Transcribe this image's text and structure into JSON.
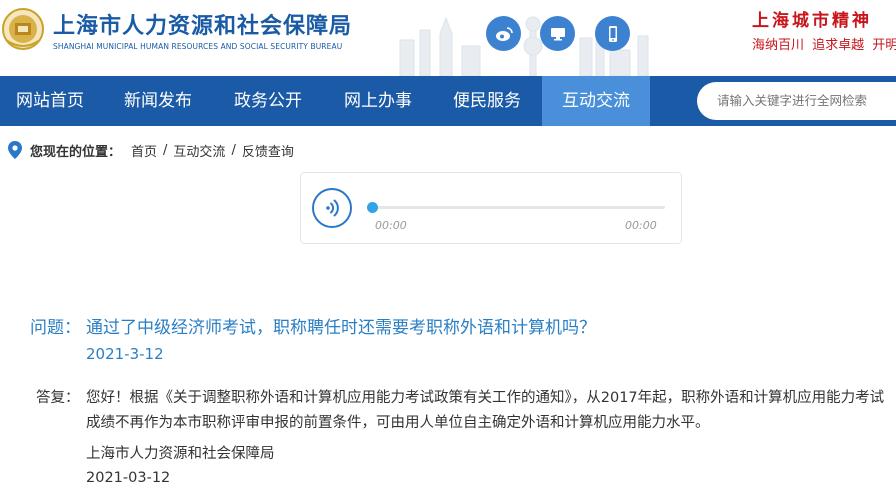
{
  "header": {
    "title": "上海市人力资源和社会保障局",
    "subtitle": "SHANGHAI MUNICIPAL HUMAN RESOURCES AND SOCIAL SECURITY BUREAU",
    "spirit": "上海城市精神",
    "motto": "海纳百川 追求卓越 开明"
  },
  "social": {
    "weibo_icon": "weibo-icon",
    "desktop_icon": "desktop-icon",
    "mobile_icon": "mobile-icon"
  },
  "nav": {
    "items": [
      {
        "label": "网站首页"
      },
      {
        "label": "新闻发布"
      },
      {
        "label": "政务公开"
      },
      {
        "label": "网上办事"
      },
      {
        "label": "便民服务"
      },
      {
        "label": "互动交流",
        "active": true
      }
    ],
    "search_placeholder": "请输入关键字进行全网检索"
  },
  "breadcrumb": {
    "label": "您现在的位置：",
    "items": [
      "首页",
      "互动交流",
      "反馈查询"
    ],
    "separator": "/"
  },
  "player": {
    "current_time": "00:00",
    "total_time": "00:00",
    "progress": 0
  },
  "qa": {
    "question_label": "问题：",
    "question": "通过了中级经济师考试，职称聘任时还需要考职称外语和计算机吗？",
    "question_date": "2021-3-12",
    "answer_label": "答复：",
    "answer": "您好！根据《关于调整职称外语和计算机应用能力考试政策有关工作的通知》，从2017年起，职称外语和计算机应用能力考试成绩不再作为本市职称评审申报的前置条件，可由用人单位自主确定外语和计算机应用能力水平。",
    "answer_org": "上海市人力资源和社会保障局",
    "answer_date": "2021-03-12"
  },
  "colors": {
    "brand_blue": "#1b5aa6",
    "nav_active": "#4a8fd9",
    "question_blue": "#2a7fc4",
    "spirit_red": "#c8161d"
  }
}
